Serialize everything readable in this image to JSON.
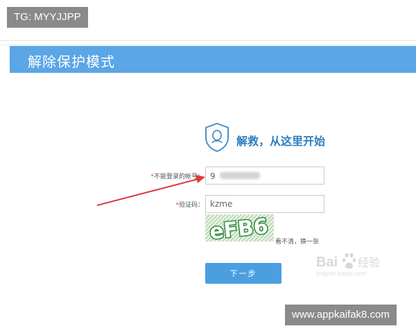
{
  "overlay": {
    "tg_label": "TG: MYYJJPP",
    "site_label": "www.appkaifak8.com"
  },
  "header": {
    "title": "解除保护模式"
  },
  "rescue": {
    "title": "解救，从这里开始"
  },
  "form": {
    "account_label": "不能登录的帐号：",
    "account_value_prefix": "9",
    "captcha_label": "验证码：",
    "captcha_value": "kzme",
    "captcha_image_text": "eFB6",
    "refresh_label": "看不清，换一张",
    "next_button": "下一步"
  },
  "watermark": {
    "brand": "Bai",
    "suffix": "经验",
    "url": "jingyan.baidu.com"
  },
  "colors": {
    "header_bg": "#5aa6e6",
    "button_bg": "#4b9fe0",
    "arrow": "#e03b3b",
    "captcha_green": "#2e8b3a"
  }
}
